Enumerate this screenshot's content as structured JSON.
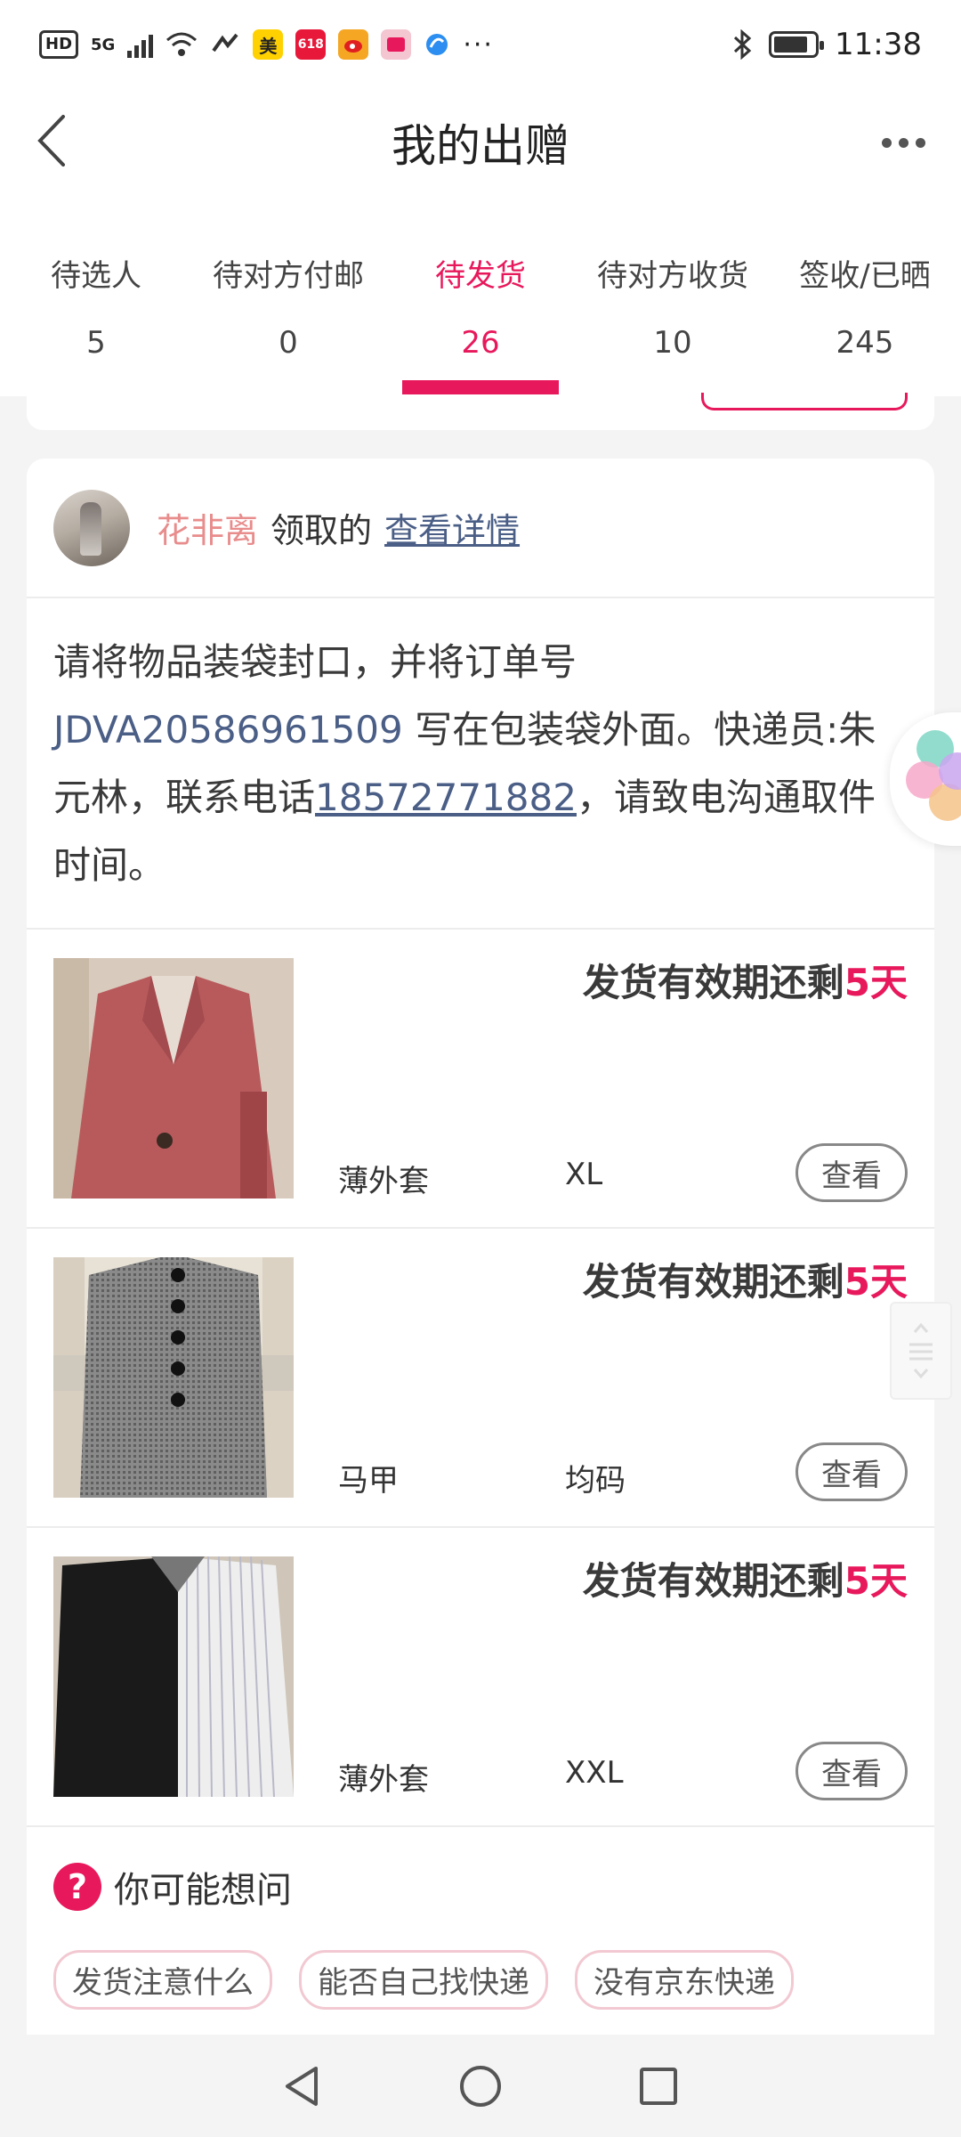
{
  "status_bar": {
    "hd": "HD",
    "network": "5G",
    "app_badge_1": "美",
    "app_badge_2": "618",
    "more": "···",
    "time": "11:38"
  },
  "header": {
    "title": "我的出赠"
  },
  "tabs": [
    {
      "label": "待选人",
      "count": "5"
    },
    {
      "label": "待对方付邮",
      "count": "0"
    },
    {
      "label": "待发货",
      "count": "26",
      "active": true
    },
    {
      "label": "待对方收货",
      "count": "10"
    },
    {
      "label": "签收/已晒",
      "count": "245"
    }
  ],
  "card": {
    "recipient": {
      "name": "花非离",
      "action": "领取的",
      "detail_link": "查看详情"
    },
    "notice": {
      "text_1": "请将物品装袋封口，并将订单号 ",
      "order_no": "JDVA20586961509",
      "text_2": " 写在包装袋外面。快递员:朱元林，联系电话",
      "phone": "18572771882",
      "text_3": "，请致电沟通取件时间。"
    },
    "items": [
      {
        "deadline_prefix": "发货有效期还剩",
        "days": "5天",
        "category": "薄外套",
        "size": "XL",
        "button": "查看"
      },
      {
        "deadline_prefix": "发货有效期还剩",
        "days": "5天",
        "category": "马甲",
        "size": "均码",
        "button": "查看"
      },
      {
        "deadline_prefix": "发货有效期还剩",
        "days": "5天",
        "category": "薄外套",
        "size": "XXL",
        "button": "查看"
      }
    ],
    "faq": {
      "icon": "?",
      "title": "你可能想问",
      "chips": [
        "发货注意什么",
        "能否自己找快递",
        "没有京东快递"
      ]
    }
  },
  "colors": {
    "accent": "#e8185c",
    "link": "#4a5e86",
    "name": "#e88c8c"
  },
  "icons": [
    "back-arrow-icon",
    "more-dots-icon",
    "question-icon",
    "nav-back-icon",
    "nav-home-icon",
    "nav-recents-icon"
  ]
}
